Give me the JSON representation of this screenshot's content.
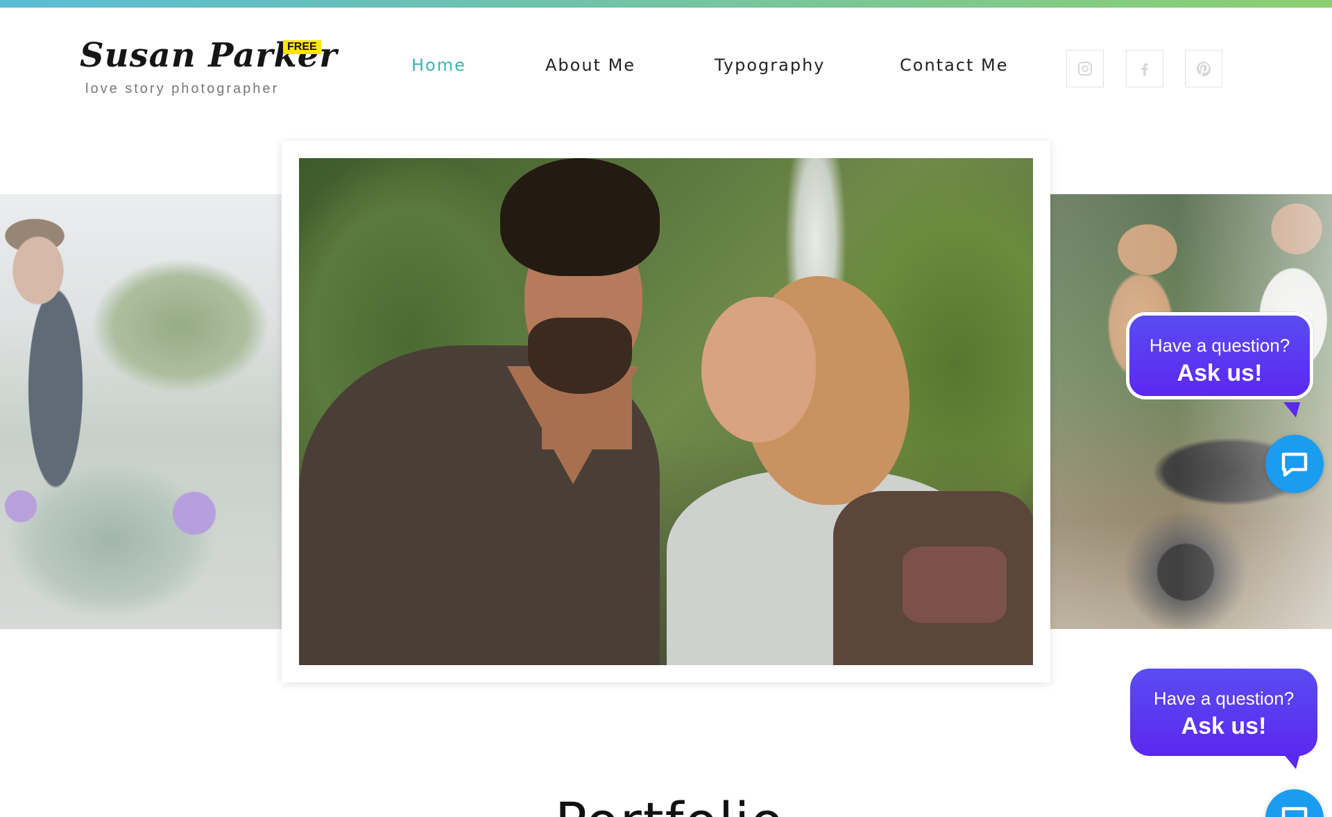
{
  "brand": {
    "title": "Susan Parker",
    "badge": "FREE",
    "subtitle": "love story photographer"
  },
  "nav": {
    "items": [
      {
        "label": "Home",
        "active": true
      },
      {
        "label": "About Me",
        "active": false
      },
      {
        "label": "Typography",
        "active": false
      },
      {
        "label": "Contact Me",
        "active": false
      }
    ],
    "social": [
      "instagram-icon",
      "facebook-icon",
      "pinterest-icon"
    ]
  },
  "chat": {
    "question": "Have a question?",
    "cta": "Ask us!"
  },
  "section": {
    "heading": "Portfolio"
  },
  "colors": {
    "accent": "#3bb3b3",
    "chat_gradient_start": "#5a4cf2",
    "chat_gradient_end": "#5b28f0",
    "chat_button": "#1a9cf0",
    "badge": "#ffe600"
  }
}
